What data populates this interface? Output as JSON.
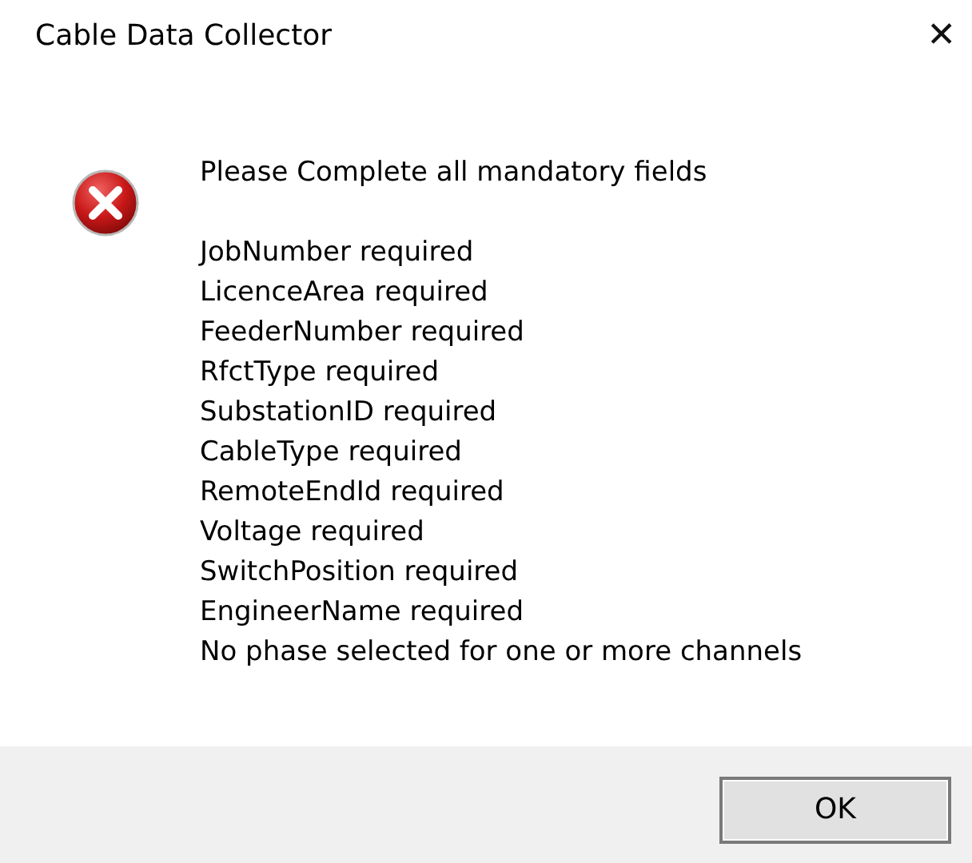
{
  "window": {
    "title": "Cable Data Collector",
    "close": "✕"
  },
  "message": {
    "kind": "error",
    "heading": "Please Complete all mandatory fields",
    "lines": [
      "JobNumber required",
      "LicenceArea required",
      "FeederNumber required",
      "RfctType required",
      "SubstationID required",
      "CableType required",
      "RemoteEndId required",
      "Voltage required",
      "SwitchPosition required",
      "EngineerName required",
      "No phase selected for one or more channels"
    ]
  },
  "buttons": [
    "OK"
  ]
}
